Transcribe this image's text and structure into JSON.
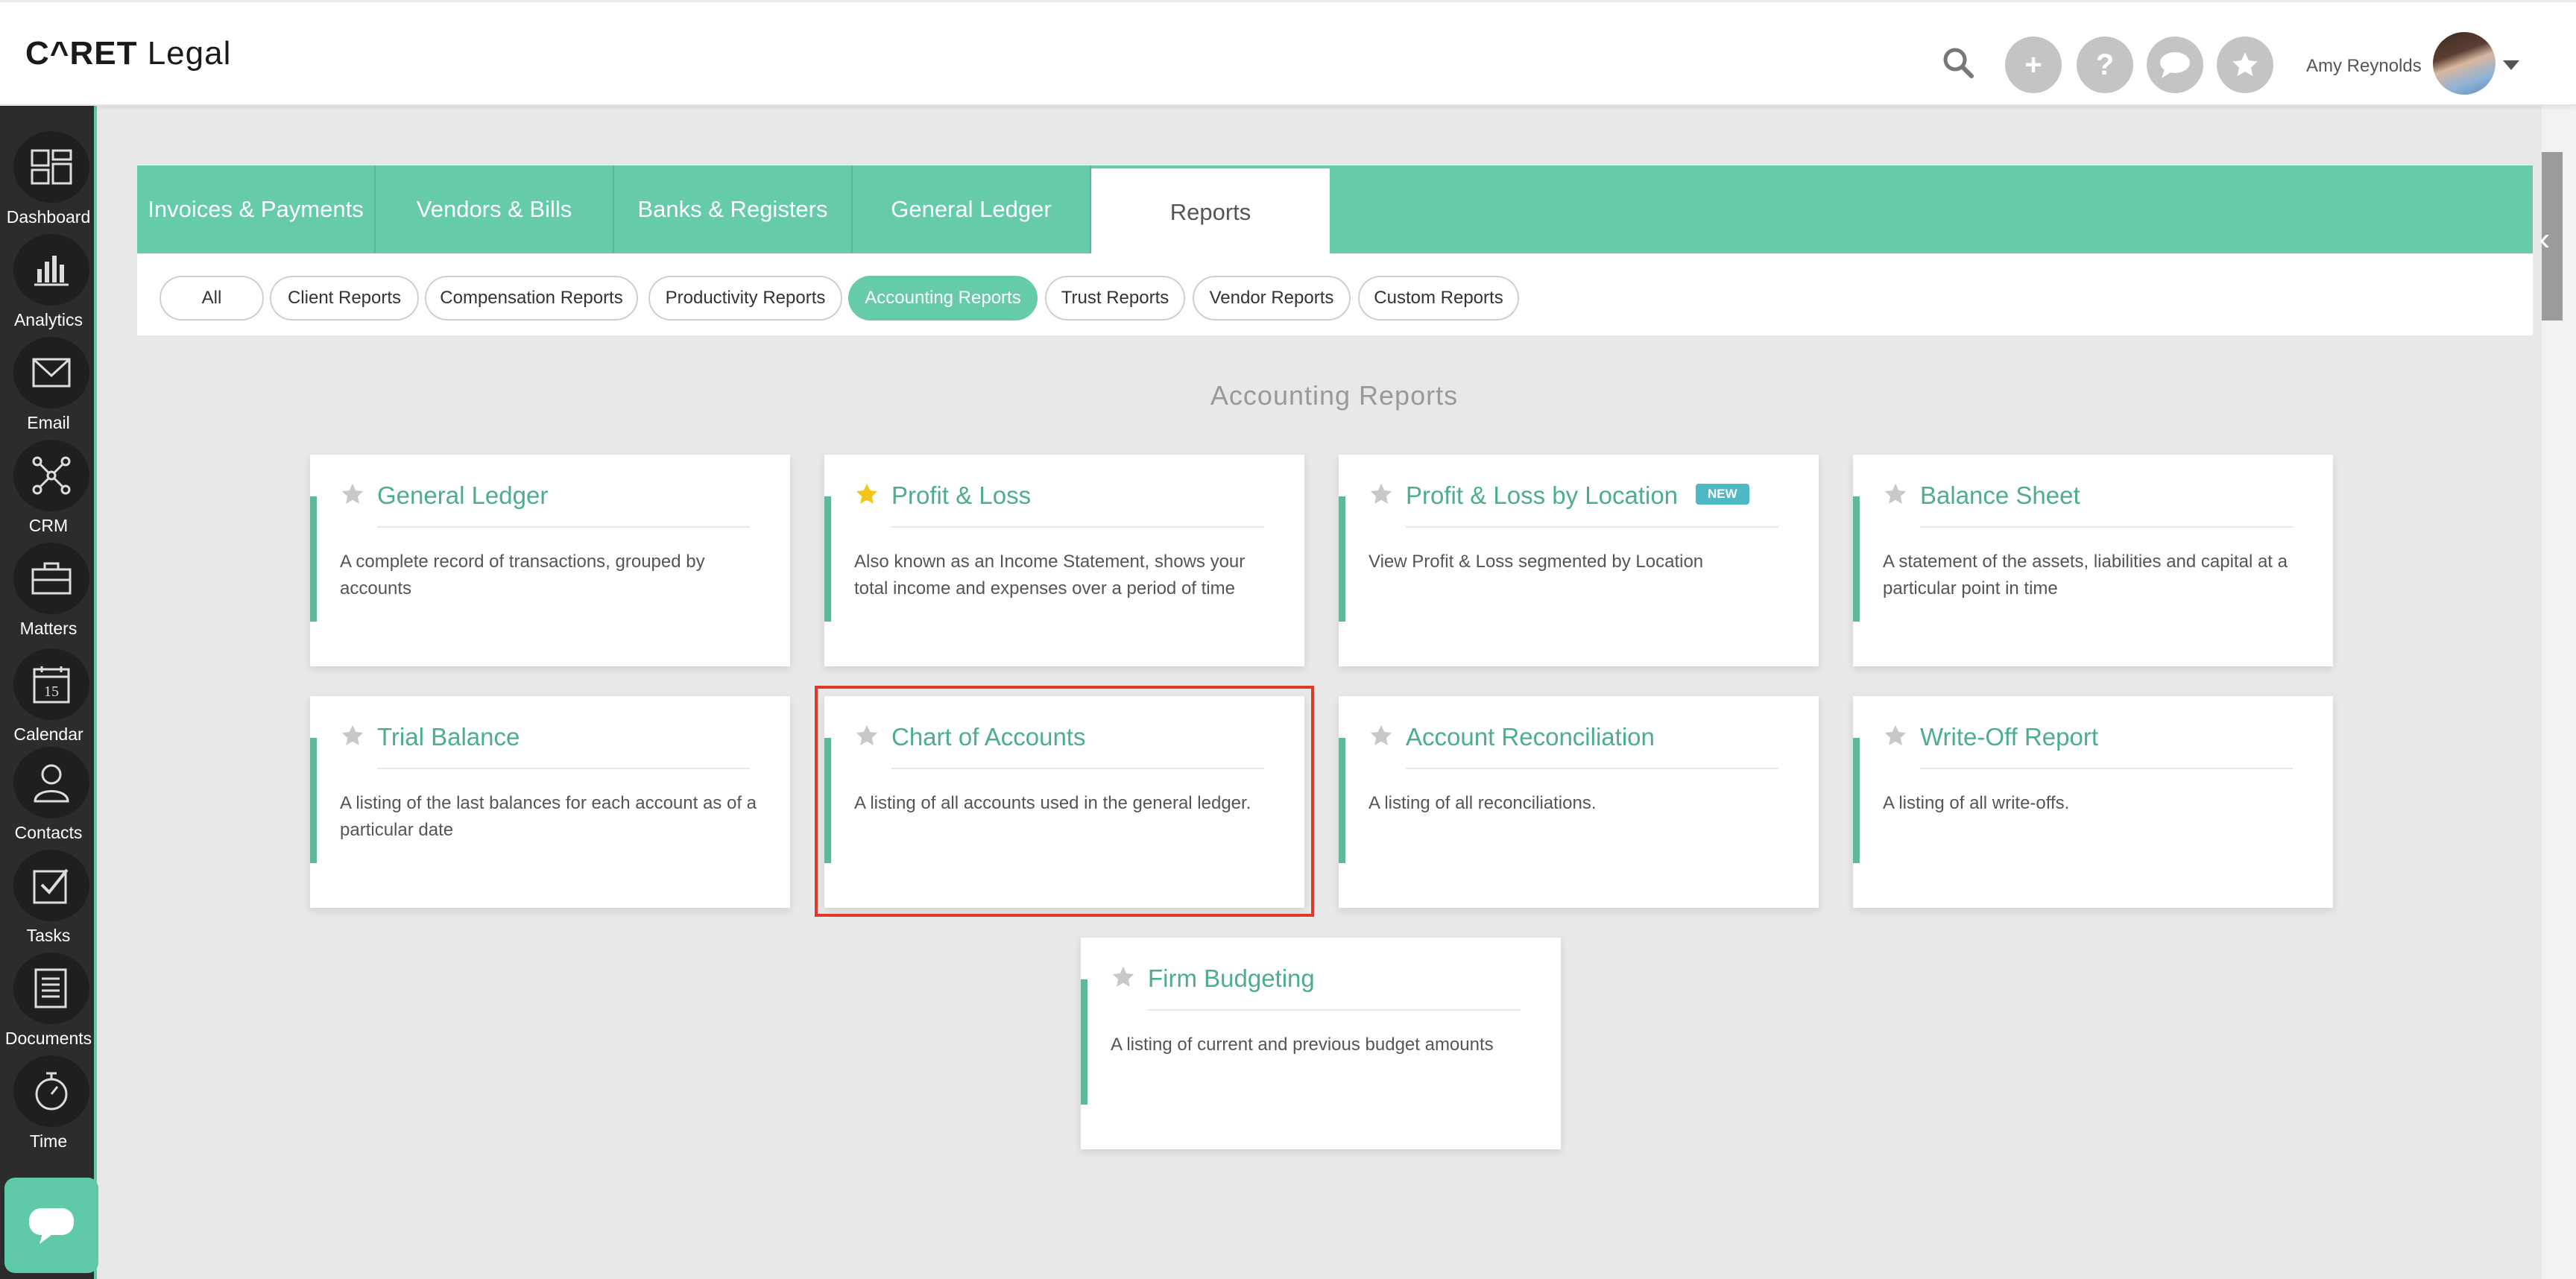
{
  "app": {
    "logo_prefix": "C^RET",
    "logo_suffix": " Legal"
  },
  "header": {
    "username": "Amy Reynolds",
    "icons": [
      "search-icon",
      "plus-icon",
      "help-icon",
      "chat-icon",
      "star-icon"
    ],
    "plus_label": "+",
    "help_label": "?"
  },
  "sidebar": {
    "items": [
      {
        "label": "Dashboard",
        "icon": "dashboard-icon"
      },
      {
        "label": "Analytics",
        "icon": "analytics-icon"
      },
      {
        "label": "Email",
        "icon": "email-icon"
      },
      {
        "label": "CRM",
        "icon": "crm-icon"
      },
      {
        "label": "Matters",
        "icon": "briefcase-icon"
      },
      {
        "label": "Calendar",
        "icon": "calendar-icon",
        "day": "15"
      },
      {
        "label": "Contacts",
        "icon": "contacts-icon"
      },
      {
        "label": "Tasks",
        "icon": "tasks-icon"
      },
      {
        "label": "Documents",
        "icon": "documents-icon"
      },
      {
        "label": "Time",
        "icon": "stopwatch-icon"
      }
    ]
  },
  "tabs": [
    {
      "label": "Invoices & Payments",
      "active": false
    },
    {
      "label": "Vendors & Bills",
      "active": false
    },
    {
      "label": "Banks & Registers",
      "active": false
    },
    {
      "label": "General Ledger",
      "active": false
    },
    {
      "label": "Reports",
      "active": true
    }
  ],
  "filters": [
    {
      "label": "All",
      "active": false
    },
    {
      "label": "Client Reports",
      "active": false
    },
    {
      "label": "Compensation Reports",
      "active": false
    },
    {
      "label": "Productivity Reports",
      "active": false
    },
    {
      "label": "Accounting Reports",
      "active": true
    },
    {
      "label": "Trust Reports",
      "active": false
    },
    {
      "label": "Vendor Reports",
      "active": false
    },
    {
      "label": "Custom Reports",
      "active": false
    }
  ],
  "section_title": "Accounting Reports",
  "cards": [
    {
      "title": "General Ledger",
      "desc": "A complete record of transactions, grouped by accounts",
      "starred": false
    },
    {
      "title": "Profit & Loss",
      "desc": "Also known as an Income Statement, shows your total income and expenses over a period of time",
      "starred": true
    },
    {
      "title": "Profit & Loss by Location",
      "desc": "View Profit & Loss segmented by Location",
      "starred": false,
      "badge": "NEW"
    },
    {
      "title": "Balance Sheet",
      "desc": "A statement of the assets, liabilities and capital at a particular point in time",
      "starred": false
    },
    {
      "title": "Trial Balance",
      "desc": "A listing of the last balances for each account as of a particular date",
      "starred": false
    },
    {
      "title": "Chart of Accounts",
      "desc": "A listing of all accounts used in the general ledger.",
      "starred": false,
      "highlighted": true
    },
    {
      "title": "Account Reconciliation",
      "desc": "A listing of all reconciliations.",
      "starred": false
    },
    {
      "title": "Write-Off Report",
      "desc": "A listing of all write-offs.",
      "starred": false
    },
    {
      "title": "Firm Budgeting",
      "desc": "A listing of current and previous budget amounts",
      "starred": false
    }
  ],
  "colors": {
    "accent": "#66cba9",
    "title_green": "#4cae8f",
    "star_gold": "#f5c518",
    "star_grey": "#c8c8c8",
    "highlight": "#e0392b",
    "badge": "#4fb8c6"
  }
}
